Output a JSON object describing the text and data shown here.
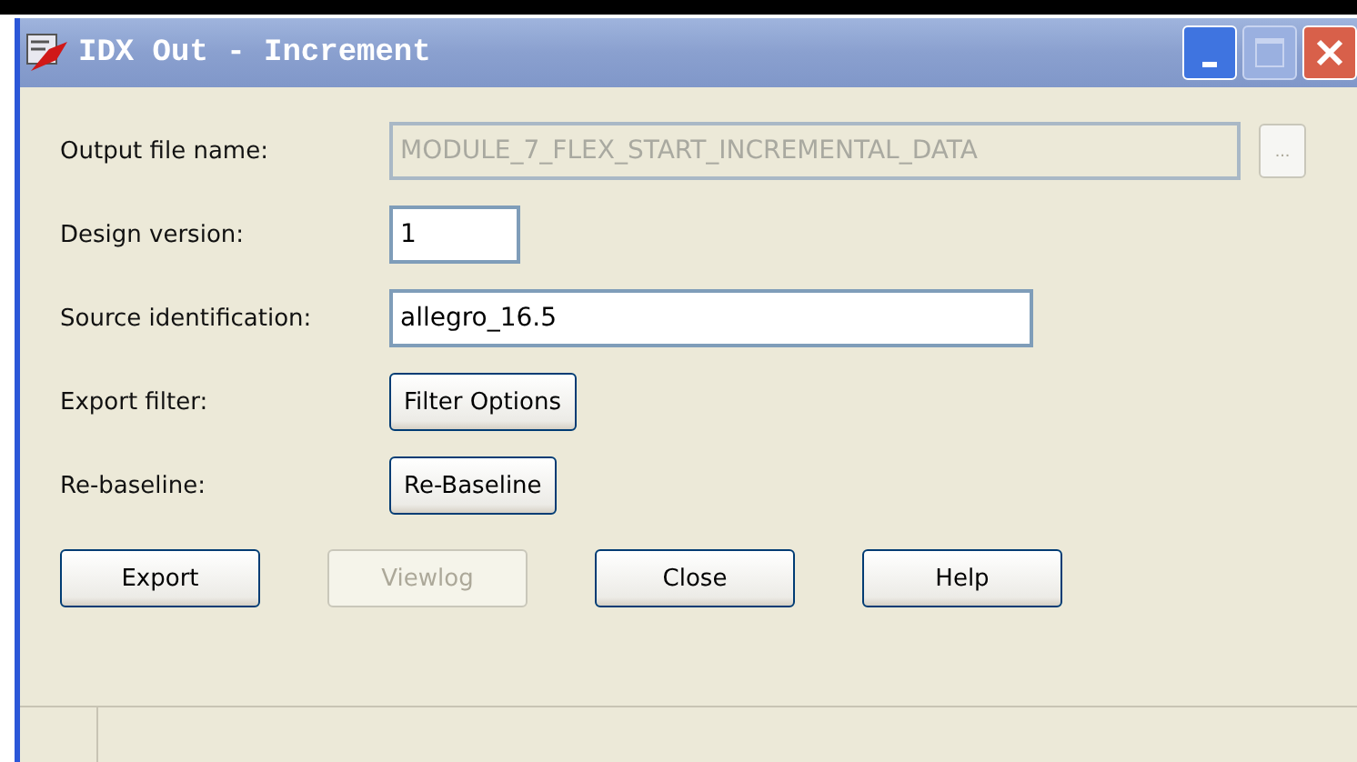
{
  "window": {
    "title": "IDX Out - Increment",
    "buttons": [
      {
        "kind": "minimize",
        "disabled": false
      },
      {
        "kind": "maximize",
        "disabled": true
      },
      {
        "kind": "close",
        "disabled": false
      }
    ]
  },
  "rows": [
    {
      "label": "Output file name:",
      "kind": "field",
      "value": "MODULE_7_FLEX_START_INCREMENTAL_DATA",
      "disabled": true,
      "browse": {
        "label": "...",
        "disabled": true
      }
    },
    {
      "label": "Design version:",
      "kind": "field",
      "value": "1",
      "disabled": false
    },
    {
      "label": "Source identification:",
      "kind": "field",
      "value": "allegro_16.5",
      "disabled": false
    },
    {
      "label": "Export filter:",
      "kind": "button",
      "button": "Filter Options"
    },
    {
      "label": "Re-baseline:",
      "kind": "button",
      "button": "Re-Baseline"
    }
  ],
  "buttons": [
    {
      "label": "Export",
      "disabled": false
    },
    {
      "label": "Viewlog",
      "disabled": true
    },
    {
      "label": "Close",
      "disabled": false
    },
    {
      "label": "Help",
      "disabled": false
    }
  ]
}
